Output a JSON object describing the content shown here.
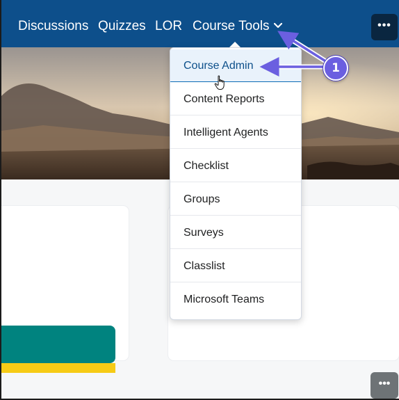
{
  "nav": {
    "items": [
      {
        "label": "Discussions"
      },
      {
        "label": "Quizzes"
      },
      {
        "label": "LOR"
      },
      {
        "label": "Course Tools"
      }
    ],
    "more_label": "•••",
    "background": "#0d4f8b"
  },
  "dropdown": {
    "items": [
      {
        "label": "Course Admin",
        "active": true
      },
      {
        "label": "Content Reports"
      },
      {
        "label": "Intelligent Agents"
      },
      {
        "label": "Checklist"
      },
      {
        "label": "Groups"
      },
      {
        "label": "Surveys"
      },
      {
        "label": "Classlist"
      },
      {
        "label": "Microsoft Teams"
      }
    ]
  },
  "annotation": {
    "badge_number": "1",
    "color": "#6b5fe0"
  },
  "content": {
    "more_label": "•••",
    "accent_teal": "#00837f",
    "accent_yellow": "#f6cb16"
  }
}
